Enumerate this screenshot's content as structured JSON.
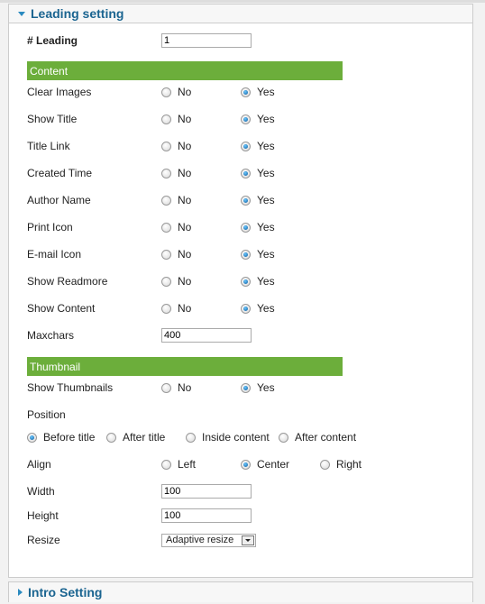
{
  "leading_panel": {
    "title": "Leading setting",
    "leading_label": "# Leading",
    "leading_value": "1",
    "content_section": "Content",
    "content_rows": [
      {
        "label": "Clear Images",
        "no": "No",
        "yes": "Yes",
        "selected": "yes"
      },
      {
        "label": "Show Title",
        "no": "No",
        "yes": "Yes",
        "selected": "yes"
      },
      {
        "label": "Title Link",
        "no": "No",
        "yes": "Yes",
        "selected": "yes"
      },
      {
        "label": "Created Time",
        "no": "No",
        "yes": "Yes",
        "selected": "yes"
      },
      {
        "label": "Author Name",
        "no": "No",
        "yes": "Yes",
        "selected": "yes"
      },
      {
        "label": "Print Icon",
        "no": "No",
        "yes": "Yes",
        "selected": "yes"
      },
      {
        "label": "E-mail Icon",
        "no": "No",
        "yes": "Yes",
        "selected": "yes"
      },
      {
        "label": "Show Readmore",
        "no": "No",
        "yes": "Yes",
        "selected": "yes"
      },
      {
        "label": "Show Content",
        "no": "No",
        "yes": "Yes",
        "selected": "yes"
      }
    ],
    "maxchars_label": "Maxchars",
    "maxchars_value": "400",
    "thumbnail_section": "Thumbnail",
    "show_thumbnails": {
      "label": "Show Thumbnails",
      "no": "No",
      "yes": "Yes",
      "selected": "yes"
    },
    "position": {
      "label": "Position",
      "options": [
        "Before title",
        "After title",
        "Inside content",
        "After content"
      ],
      "selected": "Before title"
    },
    "align": {
      "label": "Align",
      "options": [
        "Left",
        "Center",
        "Right"
      ],
      "selected": "Center"
    },
    "width_label": "Width",
    "width_value": "100",
    "height_label": "Height",
    "height_value": "100",
    "resize_label": "Resize",
    "resize_value": "Adaptive resize"
  },
  "intro_panel": {
    "title": "Intro Setting"
  },
  "colors": {
    "section_bar": "#6cae3b",
    "header_text": "#1a6490",
    "arrow": "#2a8ac0"
  }
}
